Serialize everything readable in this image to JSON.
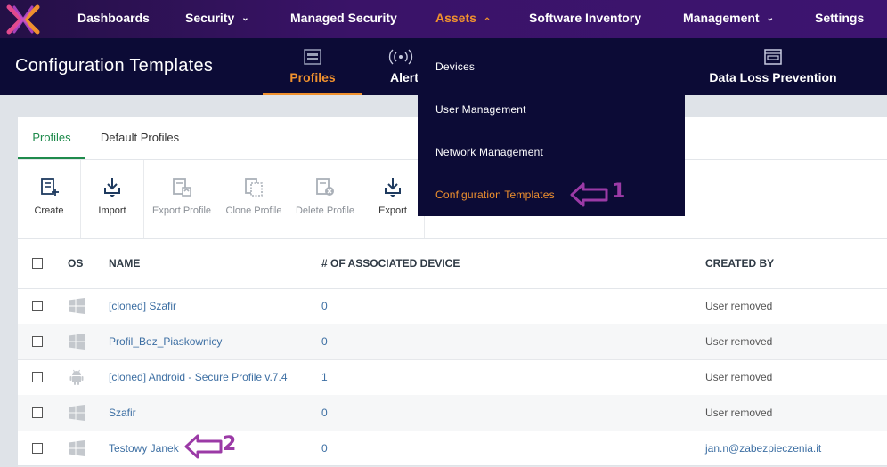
{
  "nav": {
    "items": [
      {
        "label": "Dashboards"
      },
      {
        "label": "Security"
      },
      {
        "label": "Managed Security"
      },
      {
        "label": "Assets"
      },
      {
        "label": "Software Inventory"
      },
      {
        "label": "Management"
      },
      {
        "label": "Settings"
      }
    ],
    "active": "Assets"
  },
  "header": {
    "title": "Configuration Templates",
    "tabs": [
      {
        "label": "Profiles",
        "icon": "profiles-icon"
      },
      {
        "label": "Alert",
        "icon": "alert-broadcast-icon"
      },
      {
        "label": "Data Loss Prevention",
        "icon": "dlp-icon"
      }
    ]
  },
  "dropdown": {
    "items": [
      {
        "label": "Devices"
      },
      {
        "label": "User Management"
      },
      {
        "label": "Network Management"
      },
      {
        "label": "Configuration Templates"
      }
    ]
  },
  "panel": {
    "tabs": [
      {
        "label": "Profiles"
      },
      {
        "label": "Default Profiles"
      }
    ],
    "toolbar": [
      {
        "label": "Create",
        "icon": "create-profile-icon",
        "enabled": true
      },
      {
        "label": "Import",
        "icon": "import-icon",
        "enabled": true
      },
      {
        "label": "Export Profile",
        "icon": "export-profile-icon",
        "enabled": false
      },
      {
        "label": "Clone Profile",
        "icon": "clone-profile-icon",
        "enabled": false
      },
      {
        "label": "Delete Profile",
        "icon": "delete-profile-icon",
        "enabled": false
      },
      {
        "label": "Export",
        "icon": "export-icon",
        "enabled": true
      }
    ],
    "table": {
      "columns": [
        "OS",
        "NAME",
        "# OF ASSOCIATED DEVICE",
        "CREATED BY"
      ],
      "rows": [
        {
          "os": "windows-icon",
          "name": "[cloned] Szafir",
          "devices": "0",
          "created_by": "User removed"
        },
        {
          "os": "windows-icon",
          "name": "Profil_Bez_Piaskownicy",
          "devices": "0",
          "created_by": "User removed"
        },
        {
          "os": "android-icon",
          "name": "[cloned] Android - Secure Profile v.7.4",
          "devices": "1",
          "created_by": "User removed"
        },
        {
          "os": "windows-icon",
          "name": "Szafir",
          "devices": "0",
          "created_by": "User removed"
        },
        {
          "os": "windows-icon",
          "name": "Testowy Janek",
          "devices": "0",
          "created_by": "jan.n@zabezpieczenia.it"
        }
      ]
    }
  },
  "annotations": [
    {
      "label": "1"
    },
    {
      "label": "2"
    }
  ],
  "colors": {
    "accent": "#f0912e",
    "nav_bg": "#3a1368",
    "header_bg": "#0c0b36",
    "link": "#3d6fa3",
    "tab_active": "#1f8b4c",
    "annotation": "#9b3aa6"
  }
}
